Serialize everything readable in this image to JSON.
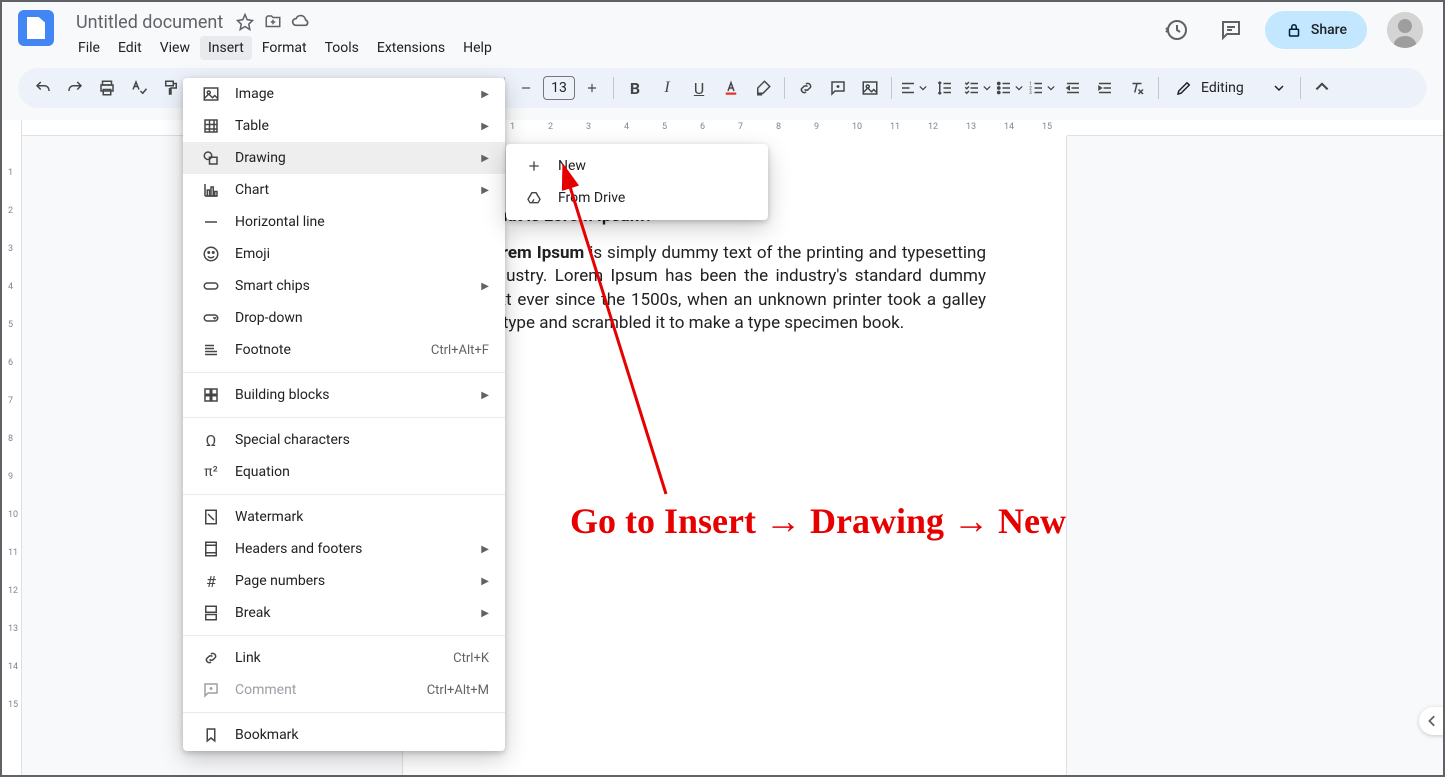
{
  "title": "Untitled document",
  "menubar": [
    "File",
    "Edit",
    "View",
    "Insert",
    "Format",
    "Tools",
    "Extensions",
    "Help"
  ],
  "share_label": "Share",
  "font_size": "13",
  "editing_label": "Editing",
  "document": {
    "heading": "What is Lorem Ipsum?",
    "body_strong": "Lorem Ipsum",
    "body_rest": " is simply dummy text of the printing and typesetting industry. Lorem Ipsum has been the industry's standard dummy text ever since the 1500s, when an unknown printer took a galley of type and scrambled it to make a type specimen book."
  },
  "insert_menu": {
    "image": "Image",
    "table": "Table",
    "drawing": "Drawing",
    "chart": "Chart",
    "horizontal_line": "Horizontal line",
    "emoji": "Emoji",
    "smart_chips": "Smart chips",
    "dropdown": "Drop-down",
    "footnote": "Footnote",
    "footnote_shortcut": "Ctrl+Alt+F",
    "building_blocks": "Building blocks",
    "special_chars": "Special characters",
    "equation": "Equation",
    "watermark": "Watermark",
    "headers_footers": "Headers and footers",
    "page_numbers": "Page numbers",
    "break": "Break",
    "link": "Link",
    "link_shortcut": "Ctrl+K",
    "comment": "Comment",
    "comment_shortcut": "Ctrl+Alt+M",
    "bookmark": "Bookmark"
  },
  "drawing_submenu": {
    "new": "New",
    "from_drive": "From Drive"
  },
  "annotation": "Go to Insert → Drawing → New",
  "hruler_ticks": [
    "1",
    "2",
    "3",
    "4",
    "5",
    "6",
    "7",
    "8",
    "9",
    "10",
    "11",
    "12",
    "13",
    "14",
    "15"
  ],
  "vruler_ticks": [
    "1",
    "2",
    "3",
    "4",
    "5",
    "6",
    "7",
    "8",
    "9",
    "10",
    "11",
    "12",
    "13",
    "14",
    "15"
  ]
}
